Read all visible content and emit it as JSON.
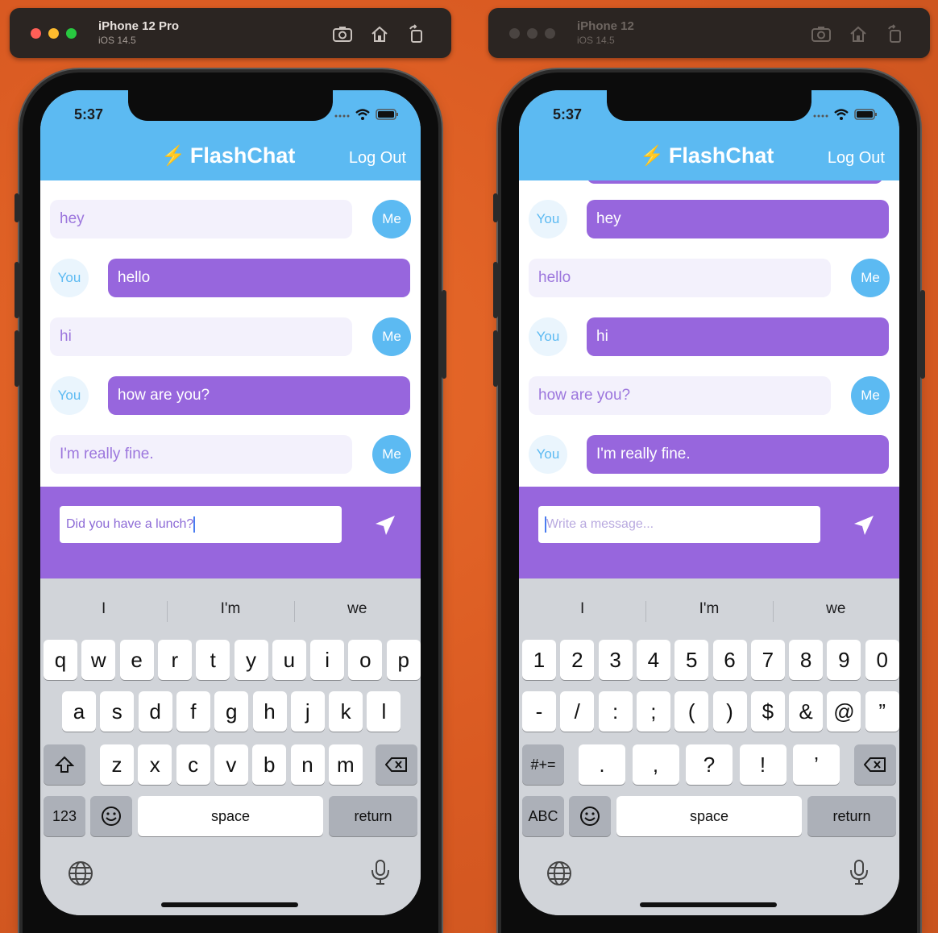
{
  "devices": [
    {
      "id": "left",
      "device_name": "iPhone 12 Pro",
      "os_version": "iOS 14.5",
      "active": true,
      "status_time": "5:37",
      "app_title": "FlashChat",
      "logout_label": "Log Out",
      "messages": [
        {
          "text": "hey",
          "sender": "Me",
          "style": "light"
        },
        {
          "text": "hello",
          "sender": "You",
          "style": "dark"
        },
        {
          "text": "hi",
          "sender": "Me",
          "style": "light"
        },
        {
          "text": "how are you?",
          "sender": "You",
          "style": "dark"
        },
        {
          "text": "I'm really fine.",
          "sender": "Me",
          "style": "light"
        }
      ],
      "input_value": "Did you have a lunch?",
      "input_placeholder": "",
      "suggestions": [
        "I",
        "I'm",
        "we"
      ],
      "keyboard_mode": "letters",
      "space_label": "space",
      "return_label": "return",
      "mode_key_label": "123"
    },
    {
      "id": "right",
      "device_name": "iPhone 12",
      "os_version": "iOS 14.5",
      "active": false,
      "status_time": "5:37",
      "app_title": "FlashChat",
      "logout_label": "Log Out",
      "messages": [
        {
          "text": "hey",
          "sender": "You",
          "style": "dark"
        },
        {
          "text": "hello",
          "sender": "Me",
          "style": "light"
        },
        {
          "text": "hi",
          "sender": "You",
          "style": "dark"
        },
        {
          "text": "how are you?",
          "sender": "Me",
          "style": "light"
        },
        {
          "text": "I'm really fine.",
          "sender": "You",
          "style": "dark"
        }
      ],
      "input_value": "",
      "input_placeholder": "Write a message...",
      "suggestions": [
        "I",
        "I'm",
        "we"
      ],
      "keyboard_mode": "numbers",
      "space_label": "space",
      "return_label": "return",
      "mode_key_label": "ABC"
    }
  ],
  "keyboards": {
    "letters": {
      "row1": [
        "q",
        "w",
        "e",
        "r",
        "t",
        "y",
        "u",
        "i",
        "o",
        "p"
      ],
      "row2": [
        "a",
        "s",
        "d",
        "f",
        "g",
        "h",
        "j",
        "k",
        "l"
      ],
      "row3": [
        "z",
        "x",
        "c",
        "v",
        "b",
        "n",
        "m"
      ]
    },
    "numbers": {
      "row1": [
        "1",
        "2",
        "3",
        "4",
        "5",
        "6",
        "7",
        "8",
        "9",
        "0"
      ],
      "row2": [
        "-",
        "/",
        ":",
        ";",
        "(",
        ")",
        "$",
        "&",
        "@",
        "”"
      ],
      "row3": [
        ".",
        ",",
        "?",
        "!",
        "’"
      ],
      "shift_label": "#+="
    }
  },
  "colors": {
    "header": "#5cbaf2",
    "bubble_dark": "#9766dd",
    "bubble_light": "#f3f1fc",
    "composer": "#9766dd",
    "background": "#d95a22"
  },
  "icons": [
    "screenshot-icon",
    "home-icon",
    "rotate-icon",
    "bolt-icon",
    "send-icon",
    "globe-icon",
    "microphone-icon",
    "shift-icon",
    "delete-icon",
    "emoji-icon",
    "wifi-icon",
    "battery-icon"
  ]
}
